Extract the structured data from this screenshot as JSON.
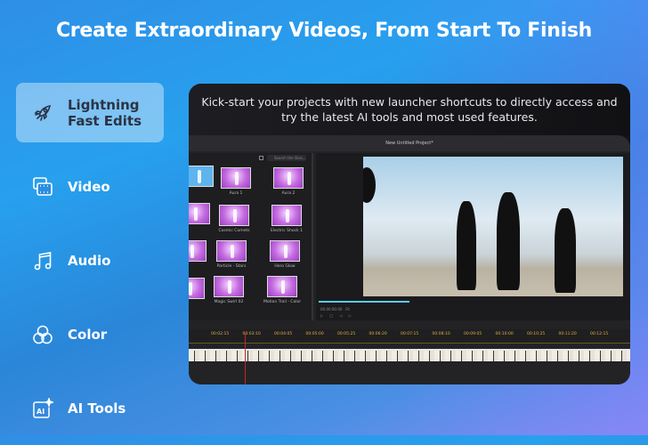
{
  "headline": "Create Extraordinary Videos, From Start To Finish",
  "sidebar": {
    "items": [
      {
        "label_line1": "Lightning",
        "label_line2": "Fast Edits",
        "icon": "rocket-icon",
        "active": true
      },
      {
        "label": "Video",
        "icon": "video-icon"
      },
      {
        "label": "Audio",
        "icon": "music-note-icon"
      },
      {
        "label": "Color",
        "icon": "color-circles-icon"
      },
      {
        "label": "AI Tools",
        "icon": "ai-sparkle-icon",
        "icon_text": "AI"
      }
    ]
  },
  "feature": {
    "caption_line1": "Kick-start your projects with new launcher shortcuts to directly access and",
    "caption_line2": "try the latest AI tools and most used features.",
    "editor": {
      "project_title": "New Untitled Project*",
      "search_placeholder": "Search the libra...",
      "effects": [
        "Aura 1",
        "Aura 2",
        "Cosmic Comets",
        "Electric Shock 1",
        "Particle - Stars",
        "Hero Glow",
        "Magic Swirl 02",
        "Motion Trail - Color"
      ],
      "zoom_select": "Fit",
      "timecode": "00:00:00:00",
      "timeline_ticks": [
        "00:02:15",
        "00:03:10",
        "00:04:05",
        "00:05:00",
        "00:05:25",
        "00:06:20",
        "00:07:15",
        "00:08:10",
        "00:09:05",
        "00:10:00",
        "00:10:25",
        "00:11:20",
        "00:12:15"
      ],
      "playback_progress": 0.3
    }
  },
  "colors": {
    "accent": "#5cc9f5",
    "timeline_ticks": "#d9b23a",
    "playhead": "#c0282c"
  }
}
